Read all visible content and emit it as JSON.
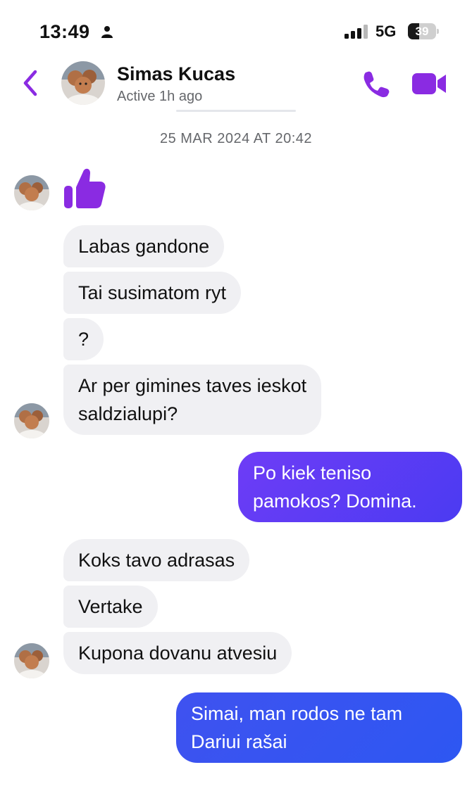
{
  "status_bar": {
    "time": "13:49",
    "network": "5G",
    "battery": "39",
    "battery_level": 0.39
  },
  "header": {
    "contact_name": "Simas Kucas",
    "contact_status": "Active 1h ago",
    "icons": {
      "back": "chevron-left-icon",
      "call": "phone-icon",
      "video": "video-camera-icon"
    },
    "accent_color": "#8a2be2"
  },
  "thread": {
    "timestamp": "25 MAR 2024 AT 20:42",
    "like_reaction": "thumbs-up-icon",
    "messages": [
      {
        "direction": "incoming",
        "text": "Labas gandone"
      },
      {
        "direction": "incoming",
        "text": "Tai susimatom ryt"
      },
      {
        "direction": "incoming",
        "text": "?"
      },
      {
        "direction": "incoming",
        "lines": [
          "Ar per gimines taves ieskot",
          "saldzialupi?"
        ]
      },
      {
        "direction": "outgoing",
        "lines": [
          "Po kiek teniso",
          "pamokos? Domina."
        ]
      },
      {
        "direction": "incoming",
        "text": "Koks tavo adrasas"
      },
      {
        "direction": "incoming",
        "text": "Vertake"
      },
      {
        "direction": "incoming",
        "text": "Kupona dovanu atvesiu"
      },
      {
        "direction": "outgoing",
        "lines": [
          "Simai, man rodos ne tam",
          "Dariui rašai"
        ]
      }
    ]
  },
  "colors": {
    "incoming_bubble": "#f0f0f3",
    "outgoing_bubble_purple": "#5b3cf4",
    "outgoing_bubble_blue": "#3454f1",
    "accent": "#8a2be2"
  }
}
